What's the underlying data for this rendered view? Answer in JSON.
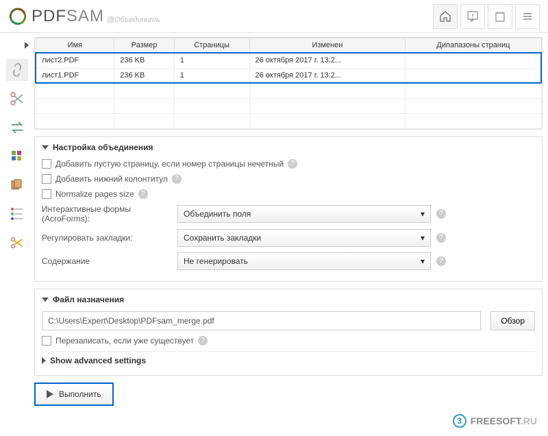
{
  "header": {
    "logo_pdf": "PDF",
    "logo_sam": "SAM",
    "subtitle": "@Объединить"
  },
  "table": {
    "columns": [
      "Имя",
      "Размер",
      "Страницы",
      "Изменен",
      "Дипапазоны страниц"
    ],
    "rows": [
      {
        "name": "лист2.PDF",
        "size": "236 KB",
        "pages": "1",
        "modified": "26 октября 2017 г. 13:2...",
        "ranges": ""
      },
      {
        "name": "лист1.PDF",
        "size": "236 KB",
        "pages": "1",
        "modified": "26 октября 2017 г. 13:2...",
        "ranges": ""
      }
    ]
  },
  "merge_settings": {
    "title": "Настройка объединения",
    "add_blank_page": "Добавить пустую страницу, если номер страницы нечетный",
    "add_footer": "Добавить нижний колонтитул",
    "normalize": "Normalize pages size",
    "forms_label": "Интерактивные формы (AcroForms):",
    "forms_value": "Объединить поля",
    "bookmarks_label": "Регулировать закладки:",
    "bookmarks_value": "Сохранить закладки",
    "toc_label": "Содержание",
    "toc_value": "Не генерировать"
  },
  "destination": {
    "title": "Файл назначения",
    "path": "C:\\Users\\Expert\\Desktop\\PDFsam_merge.pdf",
    "browse": "Обзор",
    "overwrite": "Перезаписать, если уже существует",
    "advanced": "Show advanced settings"
  },
  "run_button": "Выполнить",
  "watermark": {
    "text": "FREESOFT",
    "suffix": ".RU"
  }
}
